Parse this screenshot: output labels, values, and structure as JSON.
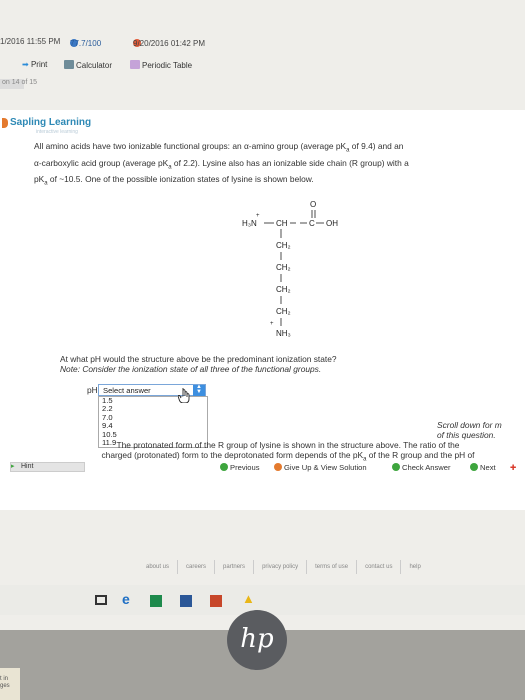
{
  "topbar": {
    "time1": "1/2016 11:55 PM",
    "score": "77.7/100",
    "time2": "9/20/2016 01:42 PM"
  },
  "toolbar": {
    "print": "Print",
    "calculator": "Calculator",
    "periodic_table": "Periodic Table"
  },
  "question_counter": "on 14 of 15",
  "brand": {
    "name": "Sapling Learning",
    "tagline": "interactive learning"
  },
  "intro": {
    "line1": "All amino acids have two ionizable functional groups: an α-amino group (average pK",
    "line1_sub": "a",
    "line1_end": " of 9.4) and an",
    "line2": "α-carboxylic acid group (average pK",
    "line2_sub": "a",
    "line2_end": " of 2.2). Lysine also has an ionizable side chain (R group) with a",
    "line3": "pK",
    "line3_sub": "a",
    "line3_end": " of ~10.5. One of the possible ionization states of lysine is shown below."
  },
  "structure": {
    "o": "O",
    "amine": "H₃N",
    "plus": "+",
    "ch": "CH",
    "c": "C",
    "oh": "OH",
    "chain": [
      "CH₂",
      "CH₂",
      "CH₂",
      "CH₂"
    ],
    "terminal": "NH₃",
    "terminal_plus": "+"
  },
  "question": {
    "text": "At what pH would the structure above be the predominant ionization state?",
    "note": "Note: Consider the ionization state of all three of the functional groups."
  },
  "answer": {
    "label": "pH =",
    "placeholder": "Select answer",
    "options": [
      "1.5",
      "2.2",
      "7.0",
      "9.4",
      "10.5",
      "11.9"
    ]
  },
  "scroll_msg": {
    "line1": "Scroll down for m",
    "line2": "of this question."
  },
  "protonated": {
    "line1": "The protonated form of the R group of lysine is shown in the structure above. The ratio of the",
    "line2": "charged (protonated) form to the deprotonated form depends of the pK",
    "line2_sub": "a",
    "line2_end": " of the R group and the pH of"
  },
  "nav": {
    "hint": "Hint",
    "previous": "Previous",
    "give_up": "Give Up & View Solution",
    "check": "Check Answer",
    "next": "Next"
  },
  "footer_links": [
    "about us",
    "careers",
    "partners",
    "privacy policy",
    "terms of use",
    "contact us",
    "help"
  ],
  "brand_logo": "hp",
  "sticky_note": {
    "line1": "t in",
    "line2": "ges"
  },
  "colors": {
    "accent": "#3d8fe0",
    "brand": "#2e89b5",
    "check_green": "#3ea53e",
    "giveup_orange": "#e47a2e"
  }
}
